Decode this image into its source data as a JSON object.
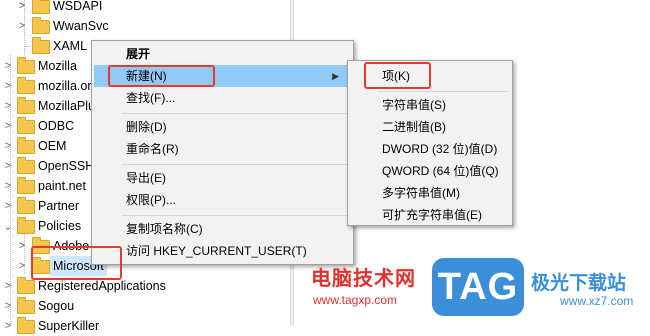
{
  "tree": {
    "items": [
      {
        "label": "WSDAPI"
      },
      {
        "label": "WwanSvc"
      },
      {
        "label": "XAML"
      },
      {
        "label": "Mozilla"
      },
      {
        "label": "mozilla.or"
      },
      {
        "label": "MozillaPlu"
      },
      {
        "label": "ODBC"
      },
      {
        "label": "OEM"
      },
      {
        "label": "OpenSSH"
      },
      {
        "label": "paint.net"
      },
      {
        "label": "Partner"
      },
      {
        "label": "Policies"
      },
      {
        "label": "Adobe"
      },
      {
        "label": "Microsoft"
      },
      {
        "label": "RegisteredApplications"
      },
      {
        "label": "Sogou"
      },
      {
        "label": "SuperKiller"
      }
    ]
  },
  "context_menu": {
    "items": [
      {
        "label": "展开"
      },
      {
        "label": "新建(N)"
      },
      {
        "label": "查找(F)..."
      },
      {
        "label": "删除(D)"
      },
      {
        "label": "重命名(R)"
      },
      {
        "label": "导出(E)"
      },
      {
        "label": "权限(P)..."
      },
      {
        "label": "复制项名称(C)"
      },
      {
        "label": "访问 HKEY_CURRENT_USER(T)"
      }
    ]
  },
  "submenu": {
    "items": [
      {
        "label": "项(K)"
      },
      {
        "label": "字符串值(S)"
      },
      {
        "label": "二进制值(B)"
      },
      {
        "label": "DWORD (32 位)值(D)"
      },
      {
        "label": "QWORD (64 位)值(Q)"
      },
      {
        "label": "多字符串值(M)"
      },
      {
        "label": "可扩充字符串值(E)"
      }
    ]
  },
  "watermark": {
    "cn_text": "电脑技术网",
    "url": "www.tagxp.com",
    "tag": "TAG",
    "site_cn": "极光下载站",
    "site_url": "www.xz7.com"
  }
}
